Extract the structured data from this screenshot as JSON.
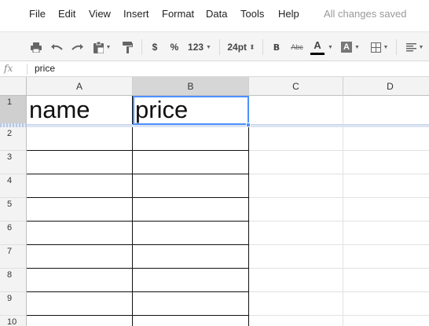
{
  "menu": {
    "items": [
      "File",
      "Edit",
      "View",
      "Insert",
      "Format",
      "Data",
      "Tools",
      "Help"
    ],
    "status": "All changes saved"
  },
  "toolbar": {
    "currency": "$",
    "percent": "%",
    "number_format": "123",
    "font_size": "24pt",
    "bold": "B",
    "strikethrough": "Abc",
    "text_color": "A",
    "fill_color": "A",
    "text_color_value": "#000000"
  },
  "formula_bar": {
    "fx": "fx",
    "value": "price"
  },
  "sheet": {
    "columns": [
      "A",
      "B",
      "C",
      "D"
    ],
    "rows": [
      "1",
      "2",
      "3",
      "4",
      "5",
      "6",
      "7",
      "8",
      "9",
      "10"
    ],
    "cells": {
      "A1": "name",
      "B1": "price"
    },
    "selected_cell": "B1"
  }
}
